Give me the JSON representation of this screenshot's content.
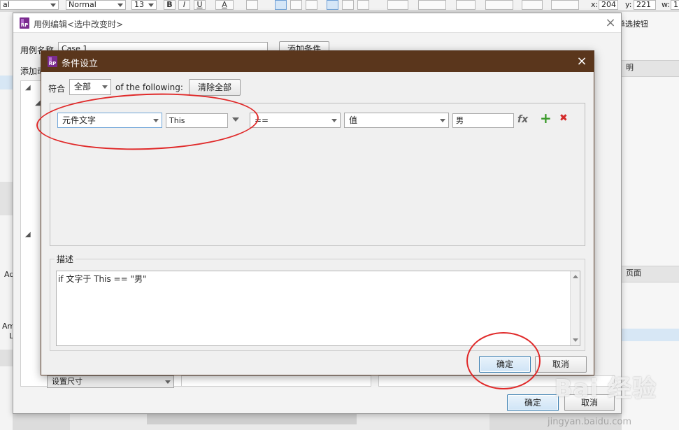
{
  "toolbar": {
    "font_name": "al",
    "style": "Normal",
    "font_size": "13",
    "bold": "B",
    "italic": "I",
    "underline": "U",
    "font_color": "A",
    "x_label": "x:",
    "x_value": "204",
    "y_label": "y:",
    "y_value": "221",
    "w_label": "w:",
    "w_value": "1"
  },
  "background": {
    "right_header": "单选按钮",
    "right_col": "明",
    "right_page": "页面",
    "left_ad": "Ad",
    "left_am": "Am",
    "left_l": "L",
    "set_size": "设置尺寸"
  },
  "outer_dialog": {
    "title": "用例编辑<选中改变时>",
    "case_name_label": "用例名称",
    "case_name_value": "Case 1",
    "add_condition_button": "添加条件",
    "add_action_label": "添加动",
    "ok_button": "确定",
    "cancel_button": "取消"
  },
  "inner_dialog": {
    "title": "条件设立",
    "match_label": "符合",
    "match_value": "全部",
    "of_following": "of the following:",
    "clear_all_button": "清除全部",
    "condition": {
      "source": "元件文字",
      "target": "This",
      "operator": "==",
      "value_type": "值",
      "value": "男",
      "fx": "fx",
      "add": "+",
      "remove": "✖"
    },
    "description_label": "描述",
    "description_text": "if 文字于 This == \"男\"",
    "ok_button": "确定",
    "cancel_button": "取消"
  },
  "watermark": {
    "brand": "Bai 经验",
    "url": "jingyan.baidu.com"
  },
  "colors": {
    "inner_title_bar": "#5a361c",
    "annotation_red": "#e02a2a",
    "add_green": "#3a9a2a",
    "remove_red": "#d42a2a"
  }
}
